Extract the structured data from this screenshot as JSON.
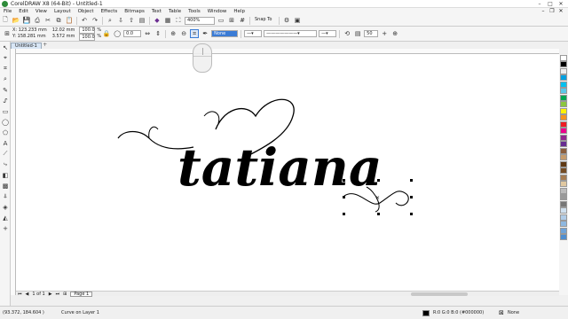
{
  "window": {
    "title": "CorelDRAW X8 (64-Bit) - Untitled-1"
  },
  "menu": [
    "File",
    "Edit",
    "View",
    "Layout",
    "Object",
    "Effects",
    "Bitmaps",
    "Text",
    "Table",
    "Tools",
    "Window",
    "Help"
  ],
  "toolbar": {
    "zoom": "400%",
    "snap_to": "Snap To"
  },
  "propbar": {
    "x": "X: 123.233 mm",
    "y": "Y: 158.281 mm",
    "w": "12.02 mm",
    "h": "3.572 mm",
    "sx": "100.0",
    "sy": "100.0",
    "pct": "%",
    "angle": "0.0",
    "outline_width": "None",
    "nodes": "50"
  },
  "tabs": {
    "doc": "Untitled-1"
  },
  "pages": {
    "counter": "1 of 1",
    "page_tab": "Page 1"
  },
  "status": {
    "cursor": "(93.372, 184.604 )",
    "object": "Curve on Layer 1",
    "fill": "R:0 G:0 B:0 (#000000)",
    "outline": "None"
  },
  "canvas": {
    "artwork_text": "tatiana"
  },
  "palette": [
    "#ffffff",
    "#000000",
    "#eeeeee",
    "#00a0e0",
    "#00c0f0",
    "#5cc8e8",
    "#00a651",
    "#8cc63f",
    "#fff200",
    "#f7941d",
    "#ed1c24",
    "#ec008c",
    "#92278f",
    "#662d91",
    "#8b5e3c",
    "#c69c6d",
    "#603913",
    "#754c24",
    "#a67c52",
    "#e0c8a0",
    "#bbbbbb",
    "#999999",
    "#777777",
    "#cfe0ef",
    "#b0cce8",
    "#8fb8e0",
    "#6fa3d8",
    "#4f8ed0"
  ]
}
